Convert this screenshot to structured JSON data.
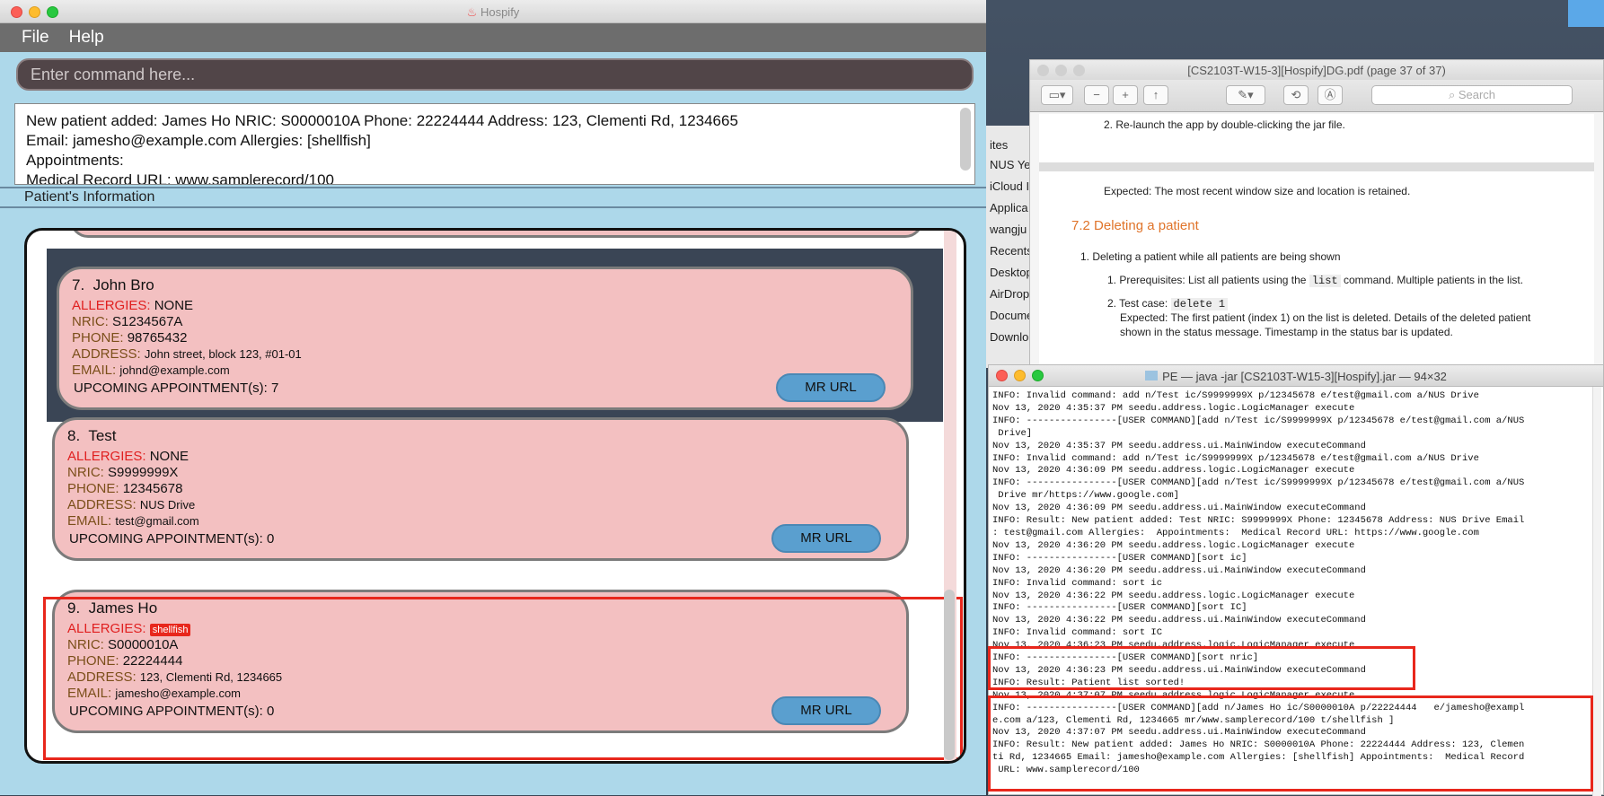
{
  "hospify": {
    "title": "Hospify",
    "menu": [
      "File",
      "Help"
    ],
    "command_placeholder": "Enter command here...",
    "result": [
      "New patient added: James Ho NRIC: S0000010A Phone: 22224444 Address: 123, Clementi Rd, 1234665",
      "Email: jamesho@example.com Allergies: [shellfish]",
      "Appointments:",
      "Medical Record URL: www.samplerecord/100"
    ],
    "section_label": "Patient's Information",
    "labels": {
      "allergies": "ALLERGIES:",
      "nric": "NRIC:",
      "phone": "PHONE:",
      "address": "ADDRESS:",
      "email": "EMAIL:",
      "appointments": "UPCOMING APPOINTMENT(s):",
      "mr_button": "MR URL"
    },
    "patients": [
      {
        "index": "7.",
        "name": "John Bro",
        "allergies": "NONE",
        "nric": "S1234567A",
        "phone": "98765432",
        "address": "John street, block 123, #01-01",
        "email": "johnd@example.com",
        "appointments": "7"
      },
      {
        "index": "8.",
        "name": "Test",
        "allergies": "NONE",
        "nric": "S9999999X",
        "phone": "12345678",
        "address": "NUS Drive",
        "email": "test@gmail.com",
        "appointments": "0"
      },
      {
        "index": "9.",
        "name": "James Ho",
        "allergy_tag": "shellfish",
        "nric": "S0000010A",
        "phone": "22224444",
        "address": "123, Clementi Rd, 1234665",
        "email": "jamesho@example.com",
        "appointments": "0"
      }
    ]
  },
  "pdf": {
    "title": "[CS2103T-W15-3][Hospify]DG.pdf (page 37 of 37)",
    "search_placeholder": "Search",
    "sidebar": [
      "ites",
      "NUS Ye",
      "iCloud I",
      "Applica",
      "wangju",
      "Recents",
      "Desktop",
      "AirDrop",
      "Docume",
      "Downlo"
    ],
    "lines": {
      "l1": "2. Re-launch the app by double-clicking the jar file.",
      "l2": "Expected: The most recent window size and location is retained.",
      "heading": "7.2 Deleting a patient",
      "l3": "1. Deleting a patient while all patients are being shown",
      "l4a": "1. Prerequisites: List all patients using the",
      "l4code": "list",
      "l4b": "command. Multiple patients in the list.",
      "l5a": "2. Test case:",
      "l5code": "delete 1",
      "l6": "Expected: The first patient (index 1) on the list is deleted. Details of the deleted patient",
      "l7": "shown in the status message. Timestamp in the status bar is updated."
    }
  },
  "terminal": {
    "title": "PE — java -jar [CS2103T-W15-3][Hospify].jar — 94×32",
    "lines": [
      "INFO: Invalid command: add n/Test ic/S9999999X p/12345678 e/test@gmail.com a/NUS Drive",
      "Nov 13, 2020 4:35:37 PM seedu.address.logic.LogicManager execute",
      "INFO: ----------------[USER COMMAND][add n/Test ic/S9999999X p/12345678 e/test@gmail.com a/NUS",
      " Drive]",
      "Nov 13, 2020 4:35:37 PM seedu.address.ui.MainWindow executeCommand",
      "INFO: Invalid command: add n/Test ic/S9999999X p/12345678 e/test@gmail.com a/NUS Drive",
      "Nov 13, 2020 4:36:09 PM seedu.address.logic.LogicManager execute",
      "INFO: ----------------[USER COMMAND][add n/Test ic/S9999999X p/12345678 e/test@gmail.com a/NUS",
      " Drive mr/https://www.google.com]",
      "Nov 13, 2020 4:36:09 PM seedu.address.ui.MainWindow executeCommand",
      "INFO: Result: New patient added: Test NRIC: S9999999X Phone: 12345678 Address: NUS Drive Email",
      ": test@gmail.com Allergies:  Appointments:  Medical Record URL: https://www.google.com",
      "Nov 13, 2020 4:36:20 PM seedu.address.logic.LogicManager execute",
      "INFO: ----------------[USER COMMAND][sort ic]",
      "Nov 13, 2020 4:36:20 PM seedu.address.ui.MainWindow executeCommand",
      "INFO: Invalid command: sort ic",
      "Nov 13, 2020 4:36:22 PM seedu.address.logic.LogicManager execute",
      "INFO: ----------------[USER COMMAND][sort IC]",
      "Nov 13, 2020 4:36:22 PM seedu.address.ui.MainWindow executeCommand",
      "INFO: Invalid command: sort IC",
      "Nov 13, 2020 4:36:23 PM seedu.address.logic.LogicManager execute",
      "INFO: ----------------[USER COMMAND][sort nric]",
      "Nov 13, 2020 4:36:23 PM seedu.address.ui.MainWindow executeCommand",
      "INFO: Result: Patient list sorted!",
      "Nov 13, 2020 4:37:07 PM seedu.address.logic.LogicManager execute",
      "INFO: ----------------[USER COMMAND][add n/James Ho ic/S0000010A p/22224444   e/jamesho@exampl",
      "e.com a/123, Clementi Rd, 1234665 mr/www.samplerecord/100 t/shellfish ]",
      "Nov 13, 2020 4:37:07 PM seedu.address.ui.MainWindow executeCommand",
      "INFO: Result: New patient added: James Ho NRIC: S0000010A Phone: 22224444 Address: 123, Clemen",
      "ti Rd, 1234665 Email: jamesho@example.com Allergies: [shellfish] Appointments:  Medical Record",
      " URL: www.samplerecord/100"
    ]
  },
  "colors": {
    "annotation": "#e8271c",
    "card": "#f3c0c1",
    "selected_row": "#3a4555",
    "mr_button": "#5a9fcf"
  }
}
